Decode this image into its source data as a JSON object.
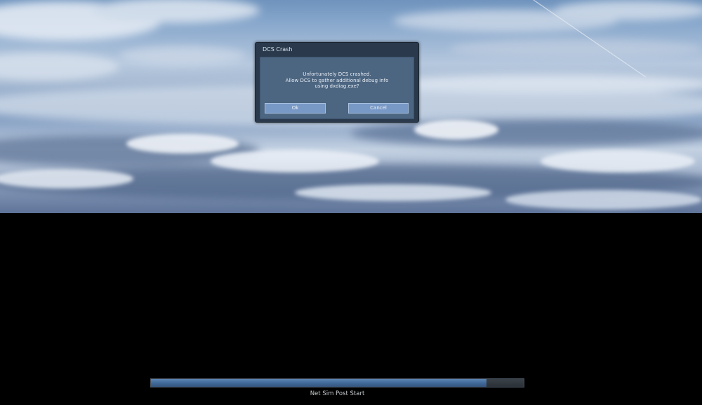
{
  "dialog": {
    "title": "DCS Crash",
    "message_lines": [
      "Unfortunately DCS crashed.",
      "Allow DCS to gather additional debug info",
      "using dxdiag.exe?"
    ],
    "ok_label": "Ok",
    "cancel_label": "Cancel"
  },
  "loading": {
    "status": "Net Sim Post Start",
    "progress": 0.9
  },
  "colors": {
    "dialog_frame": "#2a3a4c",
    "dialog_body": "#4c6580",
    "button": "#7899c6",
    "progress_fill": "#3f6796",
    "background": "#000000"
  },
  "icons": {
    "background": "sky-clouds-backdrop"
  }
}
